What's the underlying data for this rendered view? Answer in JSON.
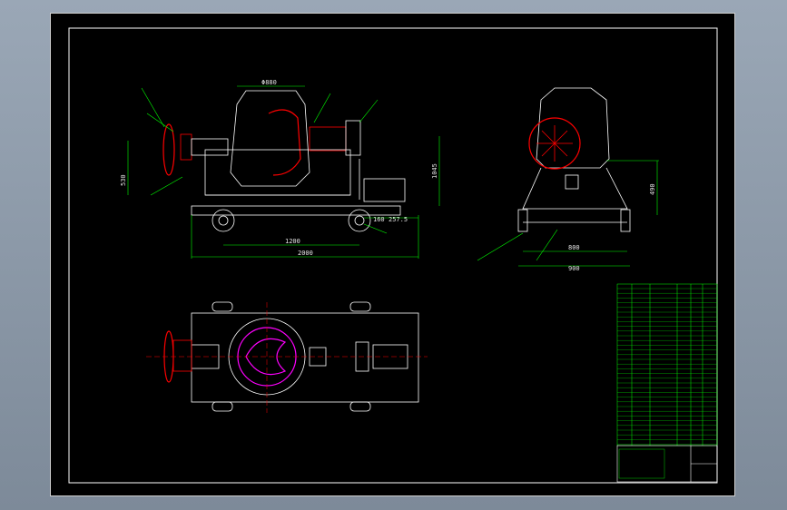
{
  "colors": {
    "background": "#000000",
    "outline": "#ffffff",
    "dimension": "#00ff00",
    "highlight": "#ff0000",
    "accent": "#ff00ff",
    "text": "#e6e6e6"
  },
  "dimensions": {
    "drum_width": "Φ880",
    "height": "530",
    "motor_height": "1045",
    "offset_a": "160",
    "offset_b": "257.5",
    "wheel_base": "1200",
    "overall_length": "2000",
    "side_height": "490",
    "track_inner": "800",
    "track_outer": "900"
  }
}
